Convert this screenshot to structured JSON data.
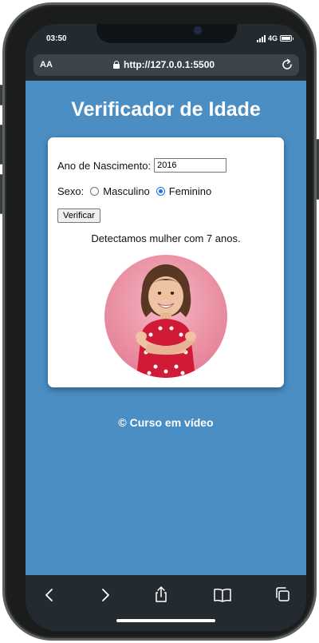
{
  "status_bar": {
    "time": "03:50",
    "network": "4G"
  },
  "browser": {
    "text_size_label": "AA",
    "url": "http://127.0.0.1:5500"
  },
  "page": {
    "title": "Verificador de Idade",
    "form": {
      "year_label": "Ano de Nascimento:",
      "year_value": "2016",
      "sex_label": "Sexo:",
      "options": [
        {
          "label": "Masculino",
          "selected": false
        },
        {
          "label": "Feminino",
          "selected": true
        }
      ],
      "verify_button": "Verificar"
    },
    "result_text": "Detectamos mulher com 7 anos.",
    "footer": "© Curso em vídeo"
  },
  "toolbar_icons": [
    "back-icon",
    "forward-icon",
    "share-icon",
    "bookmarks-icon",
    "tabs-icon"
  ],
  "colors": {
    "page_background": "#4a8ec3",
    "accent": "#1a73e8",
    "chrome": "#232b31"
  }
}
